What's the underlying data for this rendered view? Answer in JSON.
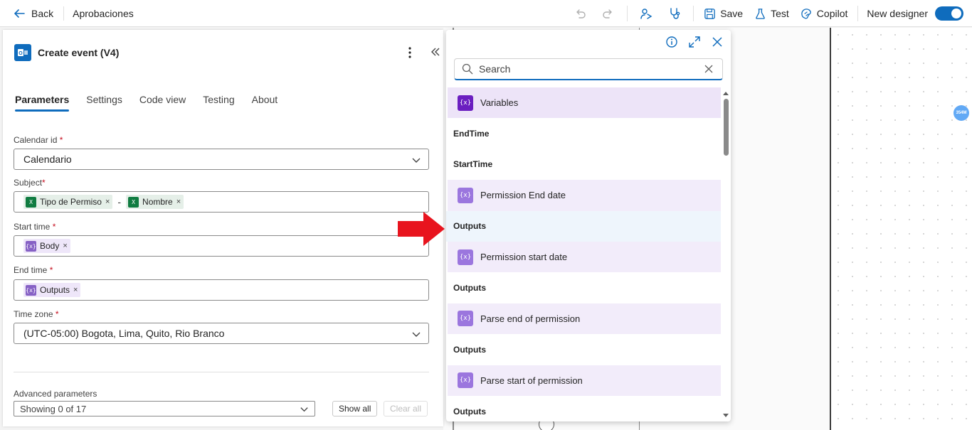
{
  "topbar": {
    "back_label": "Back",
    "title": "Aprobaciones",
    "save_label": "Save",
    "test_label": "Test",
    "copilot_label": "Copilot",
    "new_designer_label": "New designer",
    "new_designer_on": true
  },
  "panel": {
    "action_title": "Create event (V4)",
    "tabs": [
      "Parameters",
      "Settings",
      "Code view",
      "Testing",
      "About"
    ],
    "active_tab": "Parameters",
    "fields": {
      "calendar_id": {
        "label": "Calendar id",
        "value": "Calendario"
      },
      "subject": {
        "label": "Subject",
        "tokens": [
          "Tipo de Permiso",
          "Nombre"
        ],
        "separator": "-"
      },
      "start_time": {
        "label": "Start time",
        "tokens": [
          "Body"
        ]
      },
      "end_time": {
        "label": "End time",
        "tokens": [
          "Outputs"
        ]
      },
      "time_zone": {
        "label": "Time zone",
        "value": "(UTC-05:00) Bogota, Lima, Quito, Rio Branco"
      }
    },
    "advanced": {
      "label": "Advanced parameters",
      "select_value": "Showing 0 of 17",
      "show_all": "Show all",
      "clear_all": "Clear all"
    }
  },
  "flyout": {
    "search_placeholder": "Search",
    "rows": [
      {
        "kind": "item",
        "style": "var",
        "icon": "variables-icon",
        "label": "Variables"
      },
      {
        "kind": "group",
        "label": "EndTime"
      },
      {
        "kind": "group",
        "label": "StartTime"
      },
      {
        "kind": "item",
        "style": "dyn",
        "icon": "variable-icon",
        "label": "Permission End date"
      },
      {
        "kind": "group",
        "label": "Outputs",
        "highlight": true
      },
      {
        "kind": "item",
        "style": "dyn",
        "icon": "variable-icon",
        "label": "Permission start date"
      },
      {
        "kind": "group",
        "label": "Outputs"
      },
      {
        "kind": "item",
        "style": "dyn",
        "icon": "variable-icon",
        "label": "Parse end of permission"
      },
      {
        "kind": "group",
        "label": "Outputs"
      },
      {
        "kind": "item",
        "style": "dyn",
        "icon": "variable-icon",
        "label": "Parse start of permission"
      },
      {
        "kind": "group",
        "label": "Outputs"
      }
    ]
  },
  "canvas": {
    "badge": "354M"
  },
  "colors": {
    "accent": "#0f6cbd",
    "arrow": "#e8141e",
    "variable": "#8661c5"
  }
}
